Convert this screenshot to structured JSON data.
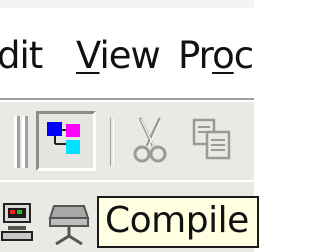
{
  "menubar": {
    "items": [
      {
        "label": "dit",
        "underline_index": -1
      },
      {
        "label": "View",
        "underline_index": 0
      },
      {
        "label": "Proc",
        "underline_index": 2
      }
    ]
  },
  "toolbar": {
    "buttons": [
      {
        "name": "tree-view",
        "icon": "tree-view-icon",
        "state": "pressed"
      },
      {
        "name": "cut",
        "icon": "scissors-icon",
        "state": "disabled"
      },
      {
        "name": "copy",
        "icon": "copy-icon",
        "state": "disabled"
      }
    ]
  },
  "toolbar2": {
    "buttons": [
      {
        "name": "build",
        "icon": "build-icon"
      },
      {
        "name": "compile",
        "icon": "compile-icon"
      }
    ]
  },
  "tooltip": {
    "text": "Compile"
  },
  "colors": {
    "menubar_bg": "#ffffff",
    "toolbar_bg": "#ebe9e4",
    "tooltip_bg": "#ffffe1",
    "icon_blue": "#0000ff",
    "icon_magenta": "#ff00ff",
    "icon_cyan": "#00e0ff",
    "disabled_gray": "#9a9a9a"
  }
}
